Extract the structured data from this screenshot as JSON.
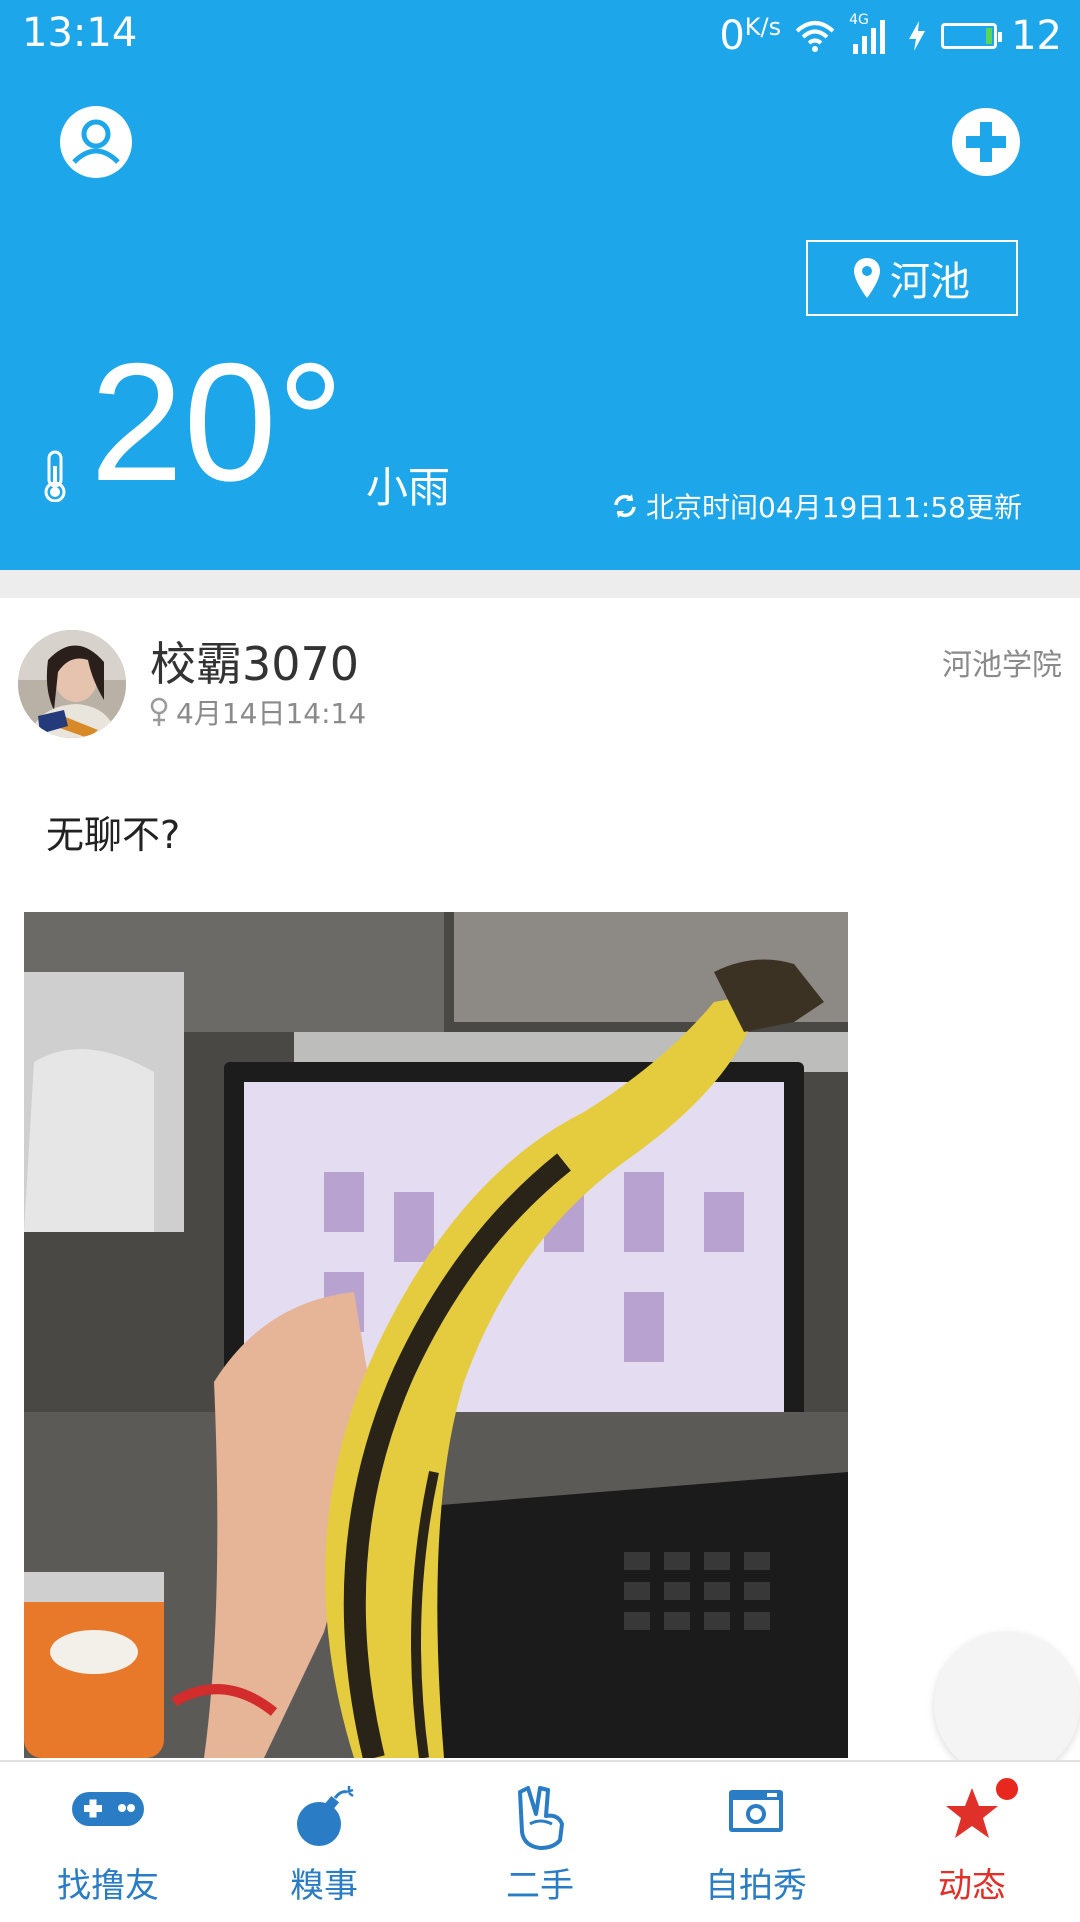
{
  "status_bar": {
    "time": "13:14",
    "net_speed": "0",
    "net_unit": "K/s",
    "network": "4G",
    "battery_level": "12"
  },
  "header": {
    "location": "河池",
    "temperature": "20°",
    "weather": "小雨",
    "updated": "北京时间04月19日11:58更新",
    "bg_color": "#1da6ea"
  },
  "post": {
    "username": "校霸3070",
    "gender_icon": "female-icon",
    "time": "4月14日14:14",
    "school": "河池学院",
    "text": "无聊不?"
  },
  "nav": {
    "items": [
      {
        "label": "找撸友",
        "icon": "gamepad-icon"
      },
      {
        "label": "糗事",
        "icon": "bomb-icon"
      },
      {
        "label": "二手",
        "icon": "victory-hand-icon"
      },
      {
        "label": "自拍秀",
        "icon": "camera-icon"
      },
      {
        "label": "动态",
        "icon": "star-icon",
        "active": true,
        "badge": true
      }
    ],
    "accent": "#2a7cc4",
    "active_color": "#e0302a"
  }
}
